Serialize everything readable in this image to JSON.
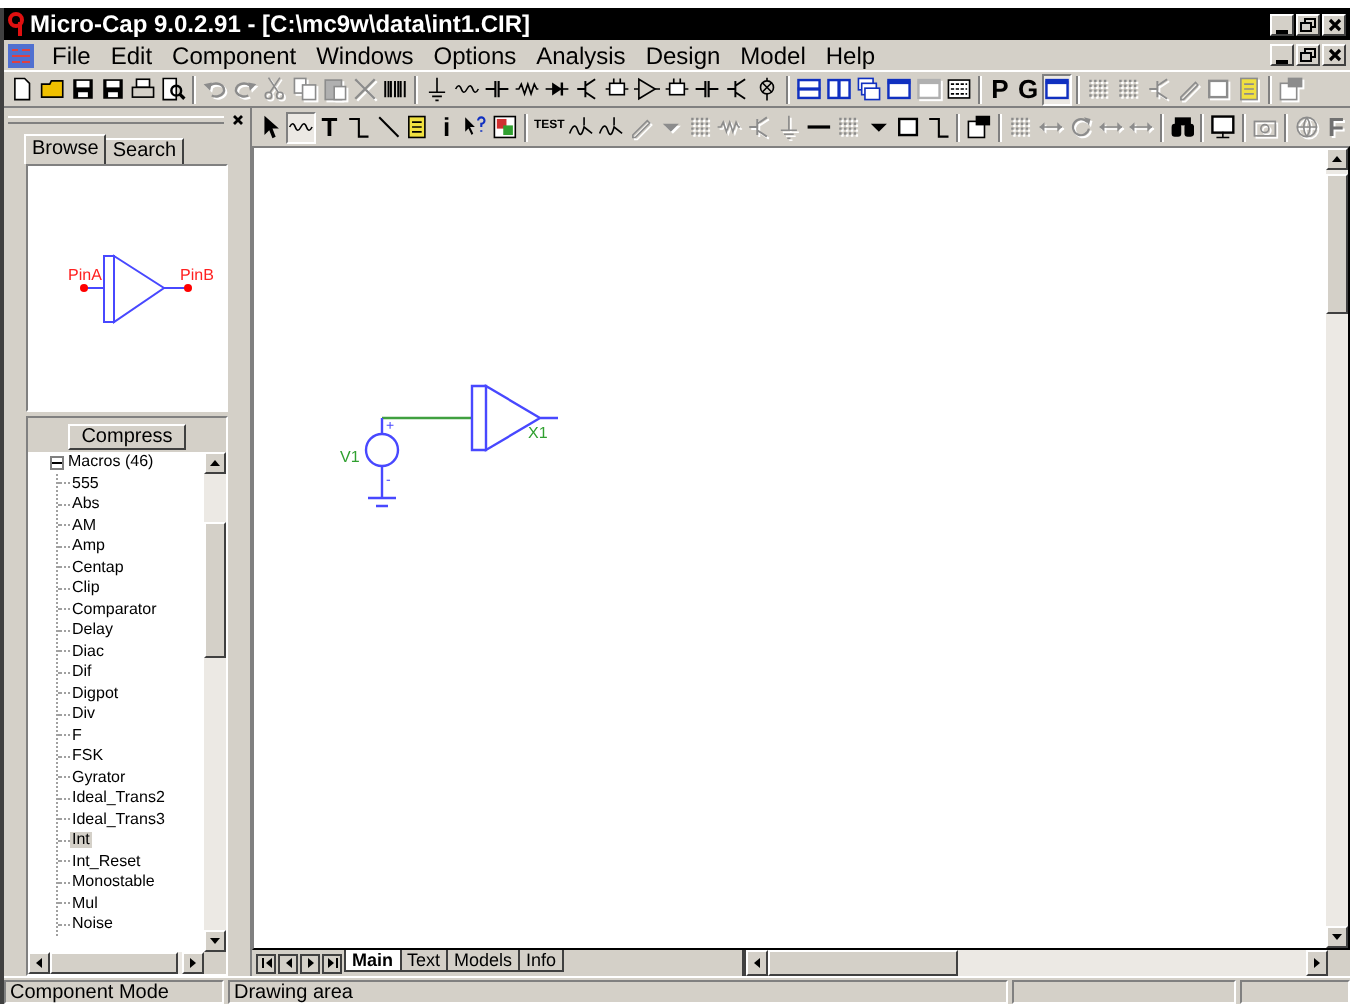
{
  "window": {
    "title": "Micro-Cap 9.0.2.91 - [C:\\mc9w\\data\\int1.CIR]"
  },
  "menu": [
    "File",
    "Edit",
    "Component",
    "Windows",
    "Options",
    "Analysis",
    "Design",
    "Model",
    "Help"
  ],
  "toolbar_1": [
    {
      "kind": "icon",
      "disabled": false,
      "pressed": false
    },
    {
      "kind": "icon",
      "disabled": false,
      "pressed": false
    },
    {
      "kind": "icon",
      "disabled": false,
      "pressed": false
    },
    {
      "kind": "icon",
      "disabled": false,
      "pressed": false
    },
    {
      "kind": "icon",
      "disabled": false,
      "pressed": false
    },
    {
      "kind": "icon",
      "disabled": false,
      "pressed": false
    },
    {
      "kind": "separator"
    },
    {
      "kind": "icon",
      "disabled": true,
      "pressed": false
    },
    {
      "kind": "icon",
      "disabled": true,
      "pressed": false
    },
    {
      "kind": "icon",
      "disabled": true,
      "pressed": false
    },
    {
      "kind": "icon",
      "disabled": true,
      "pressed": false
    },
    {
      "kind": "icon",
      "disabled": true,
      "pressed": false
    },
    {
      "kind": "icon",
      "disabled": true,
      "pressed": false
    },
    {
      "kind": "icon",
      "disabled": false,
      "pressed": false
    },
    {
      "kind": "separator"
    },
    {
      "kind": "icon",
      "disabled": false,
      "pressed": false
    },
    {
      "kind": "icon",
      "disabled": false,
      "pressed": false
    },
    {
      "kind": "icon",
      "disabled": false,
      "pressed": false
    },
    {
      "kind": "icon",
      "disabled": false,
      "pressed": false
    },
    {
      "kind": "icon",
      "disabled": false,
      "pressed": false
    },
    {
      "kind": "icon",
      "disabled": false,
      "pressed": false
    },
    {
      "kind": "icon",
      "disabled": false,
      "pressed": false
    },
    {
      "kind": "icon",
      "disabled": false,
      "pressed": false
    },
    {
      "kind": "icon",
      "disabled": false,
      "pressed": false
    },
    {
      "kind": "icon",
      "disabled": false,
      "pressed": false
    },
    {
      "kind": "icon",
      "disabled": false,
      "pressed": false
    },
    {
      "kind": "icon",
      "disabled": false,
      "pressed": false
    },
    {
      "kind": "separator"
    },
    {
      "kind": "icon",
      "disabled": false,
      "pressed": false
    },
    {
      "kind": "icon",
      "disabled": false,
      "pressed": false
    },
    {
      "kind": "icon",
      "disabled": false,
      "pressed": false
    },
    {
      "kind": "icon",
      "disabled": false,
      "pressed": false
    },
    {
      "kind": "icon",
      "disabled": true,
      "pressed": false
    },
    {
      "kind": "icon",
      "disabled": false,
      "pressed": false
    },
    {
      "kind": "separator"
    },
    {
      "kind": "text",
      "label": "P",
      "disabled": false,
      "pressed": false
    },
    {
      "kind": "text",
      "label": "G",
      "disabled": false,
      "pressed": false
    },
    {
      "kind": "icon",
      "disabled": false,
      "pressed": true
    },
    {
      "kind": "separator"
    },
    {
      "kind": "icon",
      "disabled": true,
      "pressed": false
    },
    {
      "kind": "icon",
      "disabled": true,
      "pressed": false
    },
    {
      "kind": "icon",
      "disabled": true,
      "pressed": false
    },
    {
      "kind": "icon",
      "disabled": true,
      "pressed": false
    },
    {
      "kind": "icon",
      "disabled": true,
      "pressed": false
    },
    {
      "kind": "icon",
      "disabled": true,
      "pressed": false
    },
    {
      "kind": "separator"
    },
    {
      "kind": "icon",
      "disabled": true,
      "pressed": false
    }
  ],
  "toolbar_2": [
    {
      "kind": "icon",
      "disabled": false,
      "pressed": false
    },
    {
      "kind": "icon",
      "disabled": false,
      "pressed": true
    },
    {
      "kind": "text",
      "label": "T",
      "disabled": false,
      "pressed": false
    },
    {
      "kind": "icon",
      "disabled": false,
      "pressed": false
    },
    {
      "kind": "icon",
      "disabled": false,
      "pressed": false
    },
    {
      "kind": "icon",
      "disabled": false,
      "pressed": false
    },
    {
      "kind": "text",
      "label": "i",
      "disabled": false,
      "pressed": false
    },
    {
      "kind": "icon",
      "disabled": false,
      "pressed": false
    },
    {
      "kind": "icon",
      "disabled": false,
      "pressed": false
    },
    {
      "kind": "separator"
    },
    {
      "kind": "text",
      "label": "TEST",
      "disabled": false,
      "pressed": false
    },
    {
      "kind": "icon",
      "disabled": false,
      "pressed": false
    },
    {
      "kind": "icon",
      "disabled": false,
      "pressed": false
    },
    {
      "kind": "icon",
      "disabled": true,
      "pressed": false
    },
    {
      "kind": "icon",
      "disabled": true,
      "pressed": false
    },
    {
      "kind": "icon",
      "disabled": true,
      "pressed": false
    },
    {
      "kind": "icon",
      "disabled": true,
      "pressed": false
    },
    {
      "kind": "icon",
      "disabled": true,
      "pressed": false
    },
    {
      "kind": "icon",
      "disabled": true,
      "pressed": false
    },
    {
      "kind": "icon",
      "disabled": false,
      "pressed": false
    },
    {
      "kind": "icon",
      "disabled": true,
      "pressed": false
    },
    {
      "kind": "icon",
      "disabled": false,
      "pressed": false
    },
    {
      "kind": "icon",
      "disabled": false,
      "pressed": false
    },
    {
      "kind": "icon",
      "disabled": false,
      "pressed": false
    },
    {
      "kind": "separator"
    },
    {
      "kind": "icon",
      "disabled": false,
      "pressed": false
    },
    {
      "kind": "separator"
    },
    {
      "kind": "icon",
      "disabled": true,
      "pressed": false
    },
    {
      "kind": "icon",
      "disabled": true,
      "pressed": false
    },
    {
      "kind": "icon",
      "disabled": true,
      "pressed": false
    },
    {
      "kind": "icon",
      "disabled": true,
      "pressed": false
    },
    {
      "kind": "icon",
      "disabled": true,
      "pressed": false
    },
    {
      "kind": "separator"
    },
    {
      "kind": "icon",
      "disabled": false,
      "pressed": false
    },
    {
      "kind": "separator"
    },
    {
      "kind": "icon",
      "disabled": false,
      "pressed": false
    },
    {
      "kind": "separator"
    },
    {
      "kind": "icon",
      "disabled": true,
      "pressed": false
    },
    {
      "kind": "separator"
    },
    {
      "kind": "icon",
      "disabled": true,
      "pressed": false
    },
    {
      "kind": "text",
      "label": "F",
      "disabled": true,
      "pressed": false
    }
  ],
  "browser": {
    "tabs": [
      {
        "label": "Browse",
        "selected": true
      },
      {
        "label": "Search",
        "selected": false
      }
    ],
    "preview": {
      "pins": [
        "PinA",
        "PinB"
      ]
    },
    "compress_button": "Compress",
    "tree": [
      {
        "label": "Macros (46)",
        "expanded": true,
        "children": [
          {
            "label": "555",
            "selected": false
          },
          {
            "label": "Abs",
            "selected": false
          },
          {
            "label": "AM",
            "selected": false
          },
          {
            "label": "Amp",
            "selected": false
          },
          {
            "label": "Centap",
            "selected": false
          },
          {
            "label": "Clip",
            "selected": false
          },
          {
            "label": "Comparator",
            "selected": false
          },
          {
            "label": "Delay",
            "selected": false
          },
          {
            "label": "Diac",
            "selected": false
          },
          {
            "label": "Dif",
            "selected": false
          },
          {
            "label": "Digpot",
            "selected": false
          },
          {
            "label": "Div",
            "selected": false
          },
          {
            "label": "F",
            "selected": false
          },
          {
            "label": "FSK",
            "selected": false
          },
          {
            "label": "Gyrator",
            "selected": false
          },
          {
            "label": "Ideal_Trans2",
            "selected": false
          },
          {
            "label": "Ideal_Trans3",
            "selected": false
          },
          {
            "label": "Int",
            "selected": true
          },
          {
            "label": "Int_Reset",
            "selected": false
          },
          {
            "label": "Monostable",
            "selected": false
          },
          {
            "label": "Mul",
            "selected": false
          },
          {
            "label": "Noise",
            "selected": false
          }
        ]
      }
    ]
  },
  "schematic": {
    "source": {
      "name": "V1",
      "plus": "+",
      "minus": "-"
    },
    "amplifier": {
      "name": "X1"
    }
  },
  "sheet_tabs": [
    {
      "label": "Main",
      "selected": true
    },
    {
      "label": "Text",
      "selected": false
    },
    {
      "label": "Models",
      "selected": false
    },
    {
      "label": "Info",
      "selected": false
    }
  ],
  "status_bar": [
    "Component Mode",
    "Drawing area"
  ]
}
